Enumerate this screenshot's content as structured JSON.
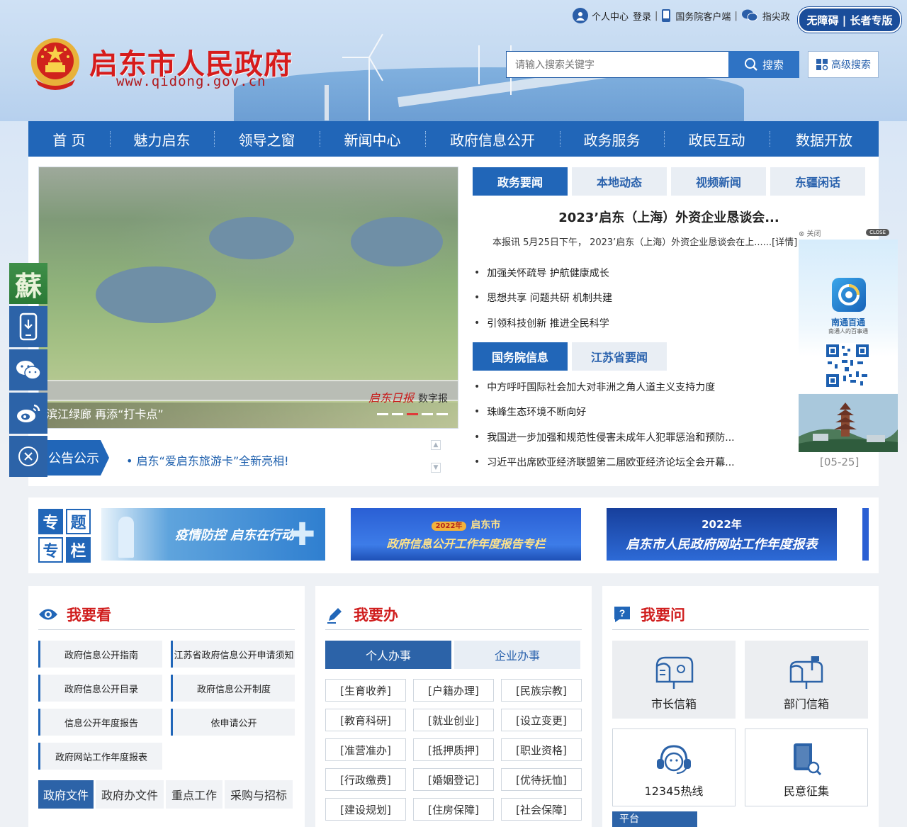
{
  "header": {
    "site_title": "启东市人民政府",
    "site_url": "www.qidong.gov.cn",
    "top_links": {
      "user_center": "个人中心",
      "login": "登录",
      "state_council_app": "国务院客户端",
      "wechat": "指尖政"
    },
    "accessibility_button": "无障碍 | 长者专版",
    "search": {
      "placeholder": "请输入搜索关键字",
      "button": "搜索",
      "advanced": "高级搜索"
    }
  },
  "nav": {
    "items": [
      {
        "label": "首 页"
      },
      {
        "label": "魅力启东"
      },
      {
        "label": "领导之窗"
      },
      {
        "label": "新闻中心"
      },
      {
        "label": "政府信息公开"
      },
      {
        "label": "政务服务"
      },
      {
        "label": "政民互动"
      },
      {
        "label": "数据开放"
      }
    ]
  },
  "slideshow": {
    "caption": "滨江绿廊 再添“打卡点”",
    "watermark": "启东日报",
    "watermark_suffix": "数字报",
    "active_index": 2,
    "dot_count": 5
  },
  "notice": {
    "label": "公告公示",
    "text": "• 启东“爱启东旅游卡”全新亮相!"
  },
  "news": {
    "tabs": [
      "政务要闻",
      "本地动态",
      "视频新闻",
      "东疆闲话"
    ],
    "active_tab": 0,
    "headline": "2023’启东（上海）外资企业恳谈会...",
    "headline_summary": "本报讯 5月25日下午， 2023’启东（上海）外资企业恳谈会在上......[详情]",
    "items": [
      "加强关怀疏导 护航健康成长",
      "思想共享 问题共研 机制共建",
      "引领科技创新 推进全民科学"
    ]
  },
  "gov_news": {
    "tabs": [
      "国务院信息",
      "江苏省要闻"
    ],
    "active_tab": 0,
    "items": [
      "中方呼吁国际社会加大对非洲之角人道主义支持力度",
      "珠峰生态环境不断向好",
      "我国进一步加强和规范性侵害未成年人犯罪惩治和预防...",
      "习近平出席欧亚经济联盟第二届欧亚经济论坛全会开幕..."
    ],
    "last_date": "[05-25]"
  },
  "float_ad": {
    "close_label": "⊗ 关闭",
    "close_badge": "CLOSE",
    "app_name": "南通百通",
    "app_slogan": "南通人的百事通"
  },
  "sidebar": {
    "items": [
      "jiangsu-logo",
      "mobile-icon",
      "wechat-icon",
      "weibo-icon",
      "close-icon"
    ],
    "jiangsu_glyph": "蘇"
  },
  "topics": {
    "tag_chars": [
      "专",
      "题",
      "专",
      "栏"
    ],
    "banner1": "疫情防控 启东在行动",
    "banner2_badge": "2022年",
    "banner2_top": "启东市",
    "banner2_bottom": "政府信息公开工作年度报告专栏",
    "banner3_top": "2022年",
    "banner3_bottom": "启东市人民政府网站工作年度报表"
  },
  "panel_see": {
    "title": "我要看",
    "items": [
      "政府信息公开指南",
      "江苏省政府信息公开申请须知",
      "政府信息公开目录",
      "政府信息公开制度",
      "信息公开年度报告",
      "依申请公开",
      "政府网站工作年度报表"
    ],
    "tabs": [
      "政府文件",
      "政府办文件",
      "重点工作",
      "采购与招标"
    ],
    "active_tab": 0
  },
  "panel_do": {
    "title": "我要办",
    "tabs": [
      "个人办事",
      "企业办事"
    ],
    "active_tab": 0,
    "items": [
      "[生育收养]",
      "[户籍办理]",
      "[民族宗教]",
      "[教育科研]",
      "[就业创业]",
      "[设立变更]",
      "[准营准办]",
      "[抵押质押]",
      "[职业资格]",
      "[行政缴费]",
      "[婚姻登记]",
      "[优待抚恤]",
      "[建设规划]",
      "[住房保障]",
      "[社会保障]"
    ]
  },
  "panel_ask": {
    "title": "我要问",
    "cards": [
      "市长信箱",
      "部门信箱",
      "12345热线",
      "民意征集"
    ],
    "platform_label": "平台"
  },
  "colors": {
    "brand_blue": "#2166b8",
    "title_red": "#d61c1c"
  }
}
